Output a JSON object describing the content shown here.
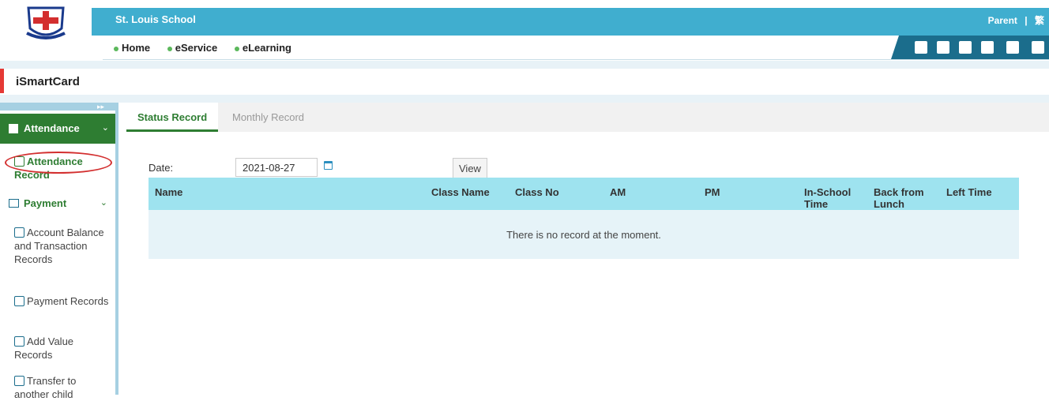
{
  "header": {
    "school_name": "St. Louis School",
    "user_role": "Parent",
    "separator": "|",
    "language_toggle": "繁",
    "nav_links": [
      "Home",
      "eService",
      "eLearning"
    ]
  },
  "page": {
    "title": "iSmartCard"
  },
  "sidebar": {
    "attendance_group": "Attendance",
    "attendance_record": "Attendance Record",
    "payment_group": "Payment",
    "payment_items": [
      "Account Balance and Transaction Records",
      "Payment Records",
      "Add Value Records",
      "Transfer to another child"
    ]
  },
  "tabs": [
    "Status Record",
    "Monthly Record"
  ],
  "form": {
    "date_label": "Date:",
    "date_value": "2021-08-27",
    "view_button": "View"
  },
  "table": {
    "columns": [
      "Name",
      "Class Name",
      "Class No",
      "AM",
      "PM",
      "In-School Time",
      "Back from Lunch",
      "Left Time"
    ],
    "empty_message": "There is no record at the moment."
  },
  "colors": {
    "topbar": "#40aecf",
    "primary_green": "#2e7d32",
    "table_header": "#9ee3ef",
    "accent_red": "#e53935"
  }
}
